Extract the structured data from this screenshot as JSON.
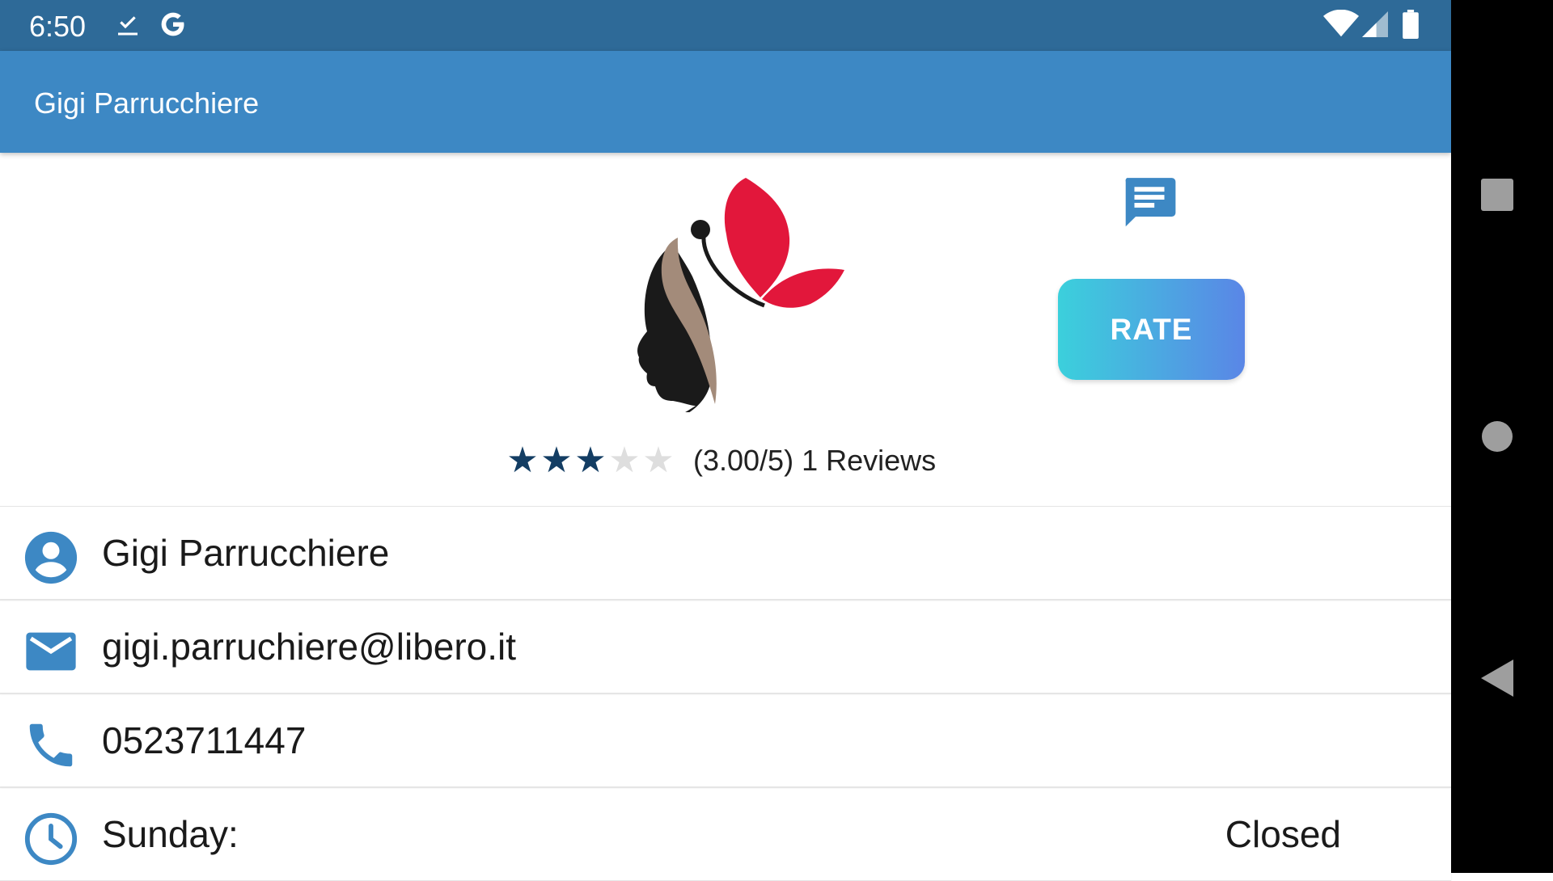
{
  "status_bar": {
    "time": "6:50",
    "icons": [
      "download-done-icon",
      "google-icon",
      "wifi-icon",
      "signal-icon",
      "battery-icon"
    ],
    "background_color": "#2e6a98"
  },
  "app_bar": {
    "title": "Gigi Parrucchiere",
    "background_color": "#3d88c4"
  },
  "header": {
    "logo_icon": "woman-butterfly-logo",
    "chat_icon": "chat-message-icon",
    "rate_label": "RATE",
    "rating": {
      "score": 3,
      "max": 5,
      "text": "(3.00/5) 1 Reviews"
    }
  },
  "info": {
    "name": "Gigi Parrucchiere",
    "email": "gigi.parruchiere@libero.it",
    "phone": "0523711447",
    "hours": [
      {
        "day": "Sunday:",
        "value": "Closed"
      }
    ]
  },
  "colors": {
    "accent": "#3d88c4",
    "star_filled": "#133d63",
    "star_empty": "#dedede",
    "rate_gradient_start": "#3bd0dc",
    "rate_gradient_end": "#5a86e6",
    "logo_red": "#e2173b"
  }
}
